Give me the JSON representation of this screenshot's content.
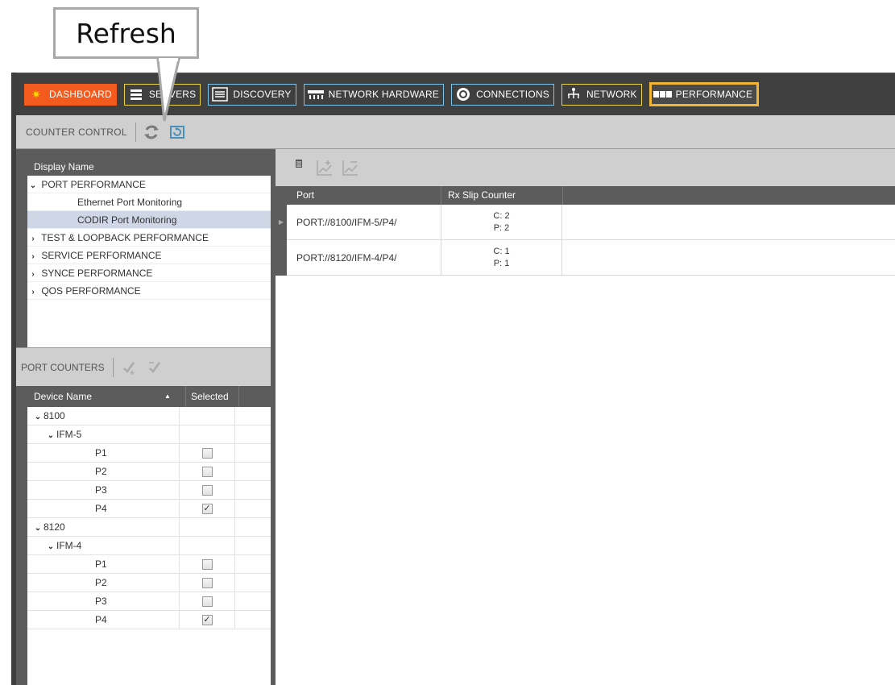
{
  "callout": {
    "label": "Refresh"
  },
  "nav": {
    "dashboard": "DASHBOARD",
    "servers": "SERVERS",
    "discovery": "DISCOVERY",
    "network_hardware": "NETWORK HARDWARE",
    "connections": "CONNECTIONS",
    "network": "NETWORK",
    "performance": "PERFORMANCE",
    "active": "PERFORMANCE",
    "colors": {
      "dashboard_bg": "#f25a1e",
      "active_border": "#f2b534",
      "nav_border": "#7ec4ea"
    }
  },
  "counter_control": {
    "label": "COUNTER CONTROL"
  },
  "display_tree": {
    "header": "Display Name",
    "items": [
      {
        "label": "PORT PERFORMANCE",
        "expanded": true
      },
      {
        "label": "Ethernet Port Monitoring"
      },
      {
        "label": "CODIR Port Monitoring",
        "selected": true
      },
      {
        "label": "TEST & LOOPBACK PERFORMANCE"
      },
      {
        "label": "SERVICE PERFORMANCE"
      },
      {
        "label": "SYNCE PERFORMANCE"
      },
      {
        "label": "QOS PERFORMANCE"
      }
    ]
  },
  "port_counters": {
    "label": "PORT COUNTERS",
    "col_device": "Device Name",
    "col_selected": "Selected",
    "rows": [
      {
        "name": "8100"
      },
      {
        "name": "IFM-5"
      },
      {
        "name": "P1",
        "checked": false
      },
      {
        "name": "P2",
        "checked": false
      },
      {
        "name": "P3",
        "checked": false
      },
      {
        "name": "P4",
        "checked": true
      },
      {
        "name": "8120"
      },
      {
        "name": "IFM-4"
      },
      {
        "name": "P1",
        "checked": false
      },
      {
        "name": "P2",
        "checked": false
      },
      {
        "name": "P3",
        "checked": false
      },
      {
        "name": "P4",
        "checked": true
      }
    ]
  },
  "results": {
    "toolbar_csv": "CSV",
    "col_port": "Port",
    "col_rx": "Rx Slip Counter",
    "rows": [
      {
        "port": "PORT://8100/IFM-5/P4/",
        "c": "C: 2",
        "p": "P: 2"
      },
      {
        "port": "PORT://8120/IFM-4/P4/",
        "c": "C: 1",
        "p": "P: 1"
      }
    ]
  },
  "checkmark": "✓"
}
